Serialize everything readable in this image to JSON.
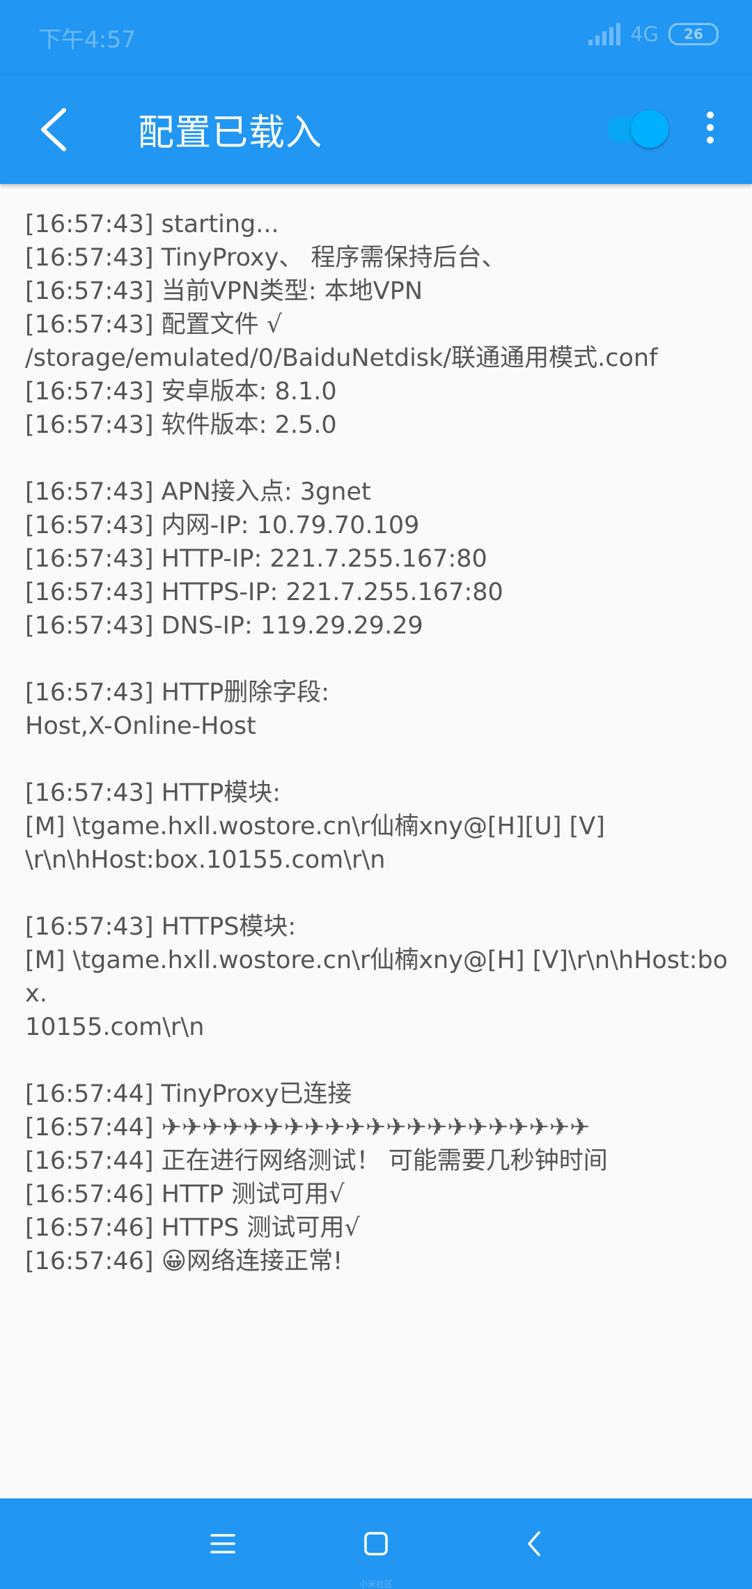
{
  "status_bar": {
    "time": "下午4:57",
    "network": "4G",
    "battery": "26"
  },
  "app_bar": {
    "title": "配置已载入",
    "toggle_on": true,
    "accent_color": "#2196F3"
  },
  "log": {
    "lines": [
      "[16:57:43] starting...",
      "[16:57:43] TinyProxy、 程序需保持后台、",
      "[16:57:43] 当前VPN类型: 本地VPN",
      "[16:57:43] 配置文件 √",
      "/storage/emulated/0/BaiduNetdisk/联通通用模式.conf",
      "[16:57:43] 安卓版本: 8.1.0",
      "[16:57:43] 软件版本: 2.5.0",
      "",
      "[16:57:43] APN接入点: 3gnet",
      "[16:57:43] 内网-IP: 10.79.70.109",
      "[16:57:43] HTTP-IP: 221.7.255.167:80",
      "[16:57:43] HTTPS-IP: 221.7.255.167:80",
      "[16:57:43] DNS-IP: 119.29.29.29",
      "",
      "[16:57:43] HTTP删除字段:",
      "Host,X-Online-Host",
      "",
      "[16:57:43] HTTP模块:",
      "[M] \\tgame.hxll.wostore.cn\\r仙楠xny@[H][U] [V]",
      "\\r\\n\\hHost:box.10155.com\\r\\n",
      "",
      "[16:57:43] HTTPS模块:",
      "[M] \\tgame.hxll.wostore.cn\\r仙楠xny@[H] [V]\\r\\n\\hHost:box.",
      "10155.com\\r\\n",
      "",
      "[16:57:44] TinyProxy已连接",
      "[16:57:44] ✈✈✈✈✈✈✈✈✈✈✈✈✈✈✈✈✈✈✈✈✈",
      "[16:57:44] 正在进行网络测试！ 可能需要几秒钟时间",
      "[16:57:46] HTTP 测试可用√",
      "[16:57:46] HTTPS 测试可用√",
      "[16:57:46] 😀网络连接正常!"
    ]
  },
  "nav_bar": {
    "icons": [
      "menu-icon",
      "home-square-icon",
      "back-chevron-icon"
    ],
    "watermark": "小米社区"
  }
}
